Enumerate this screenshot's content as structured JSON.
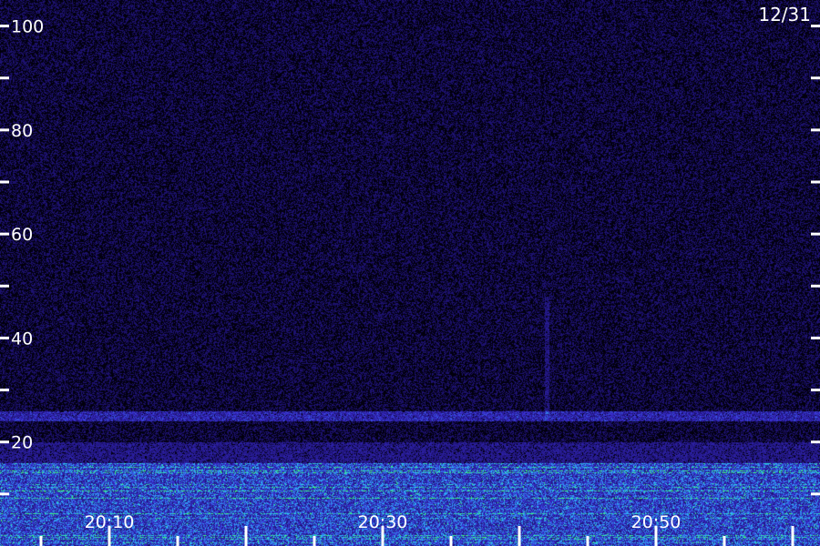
{
  "chart_data": {
    "type": "heatmap",
    "date_label": "12/31",
    "y_axis": {
      "range": [
        0,
        105
      ],
      "ticks": [
        100,
        90,
        80,
        70,
        60,
        50,
        40,
        30,
        20,
        10
      ],
      "labels": [
        {
          "value": 100,
          "text": "100"
        },
        {
          "value": 80,
          "text": "80"
        },
        {
          "value": 60,
          "text": "60"
        },
        {
          "value": 40,
          "text": "40"
        },
        {
          "value": 20,
          "text": "20"
        }
      ]
    },
    "x_axis": {
      "range": [
        "20:02",
        "21:02"
      ],
      "major_ticks": [
        "20:10",
        "20:20",
        "20:30",
        "20:40",
        "20:50",
        "21:00"
      ],
      "minor_ticks": [
        "20:05",
        "20:15",
        "20:25",
        "20:35",
        "20:45",
        "20:55"
      ],
      "labels": [
        {
          "value": "20:10",
          "text": "20:10"
        },
        {
          "value": "20:30",
          "text": "20:30"
        },
        {
          "value": "20:50",
          "text": "20:50"
        }
      ]
    },
    "features": [
      {
        "kind": "band",
        "value_from": 24,
        "value_to": 26,
        "intensity": "medium"
      },
      {
        "kind": "band",
        "value_from": 0,
        "value_to": 16,
        "intensity": "high"
      },
      {
        "kind": "streak",
        "time": "20:42",
        "value_from": 24,
        "value_to": 48
      }
    ],
    "colors": {
      "low": "#1a0f66",
      "mid": "#3b2fd6",
      "high": "#2ad3ff",
      "peak": "#3cff6a"
    }
  }
}
